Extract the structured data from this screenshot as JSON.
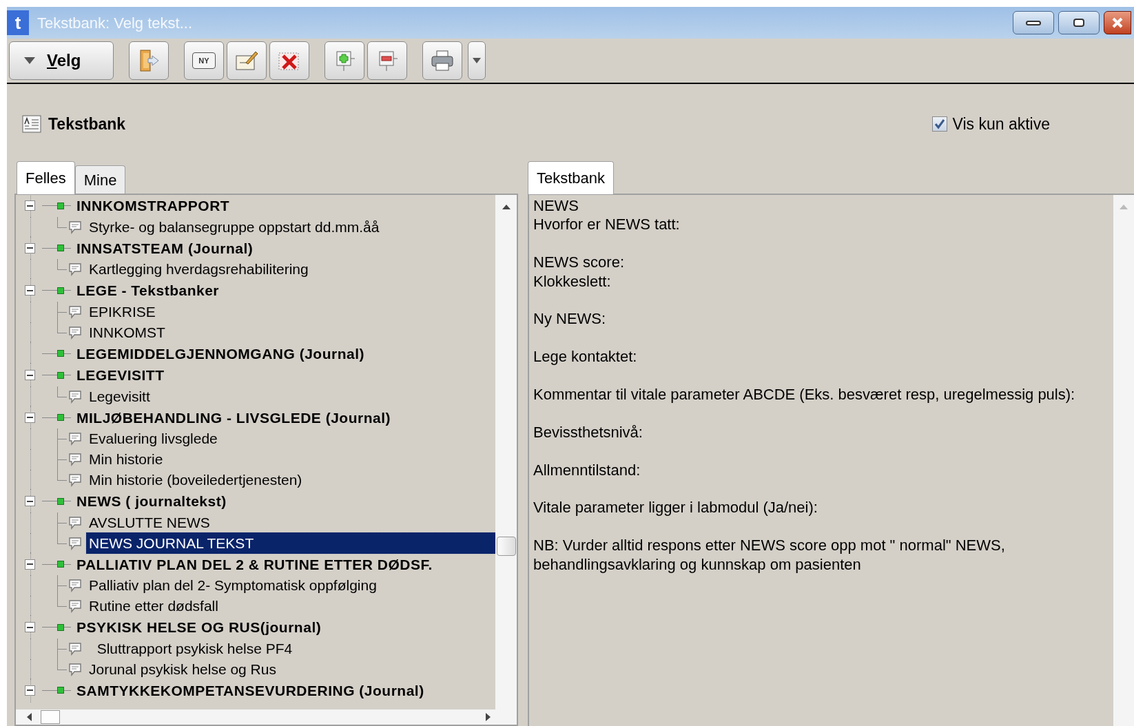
{
  "window": {
    "app_letter": "t",
    "title": "Tekstbank: Velg tekst..."
  },
  "toolbar": [
    {
      "kind": "menu",
      "label": "Velg"
    },
    {
      "kind": "exit"
    },
    {
      "kind": "new",
      "label": "NY"
    },
    {
      "kind": "edit"
    },
    {
      "kind": "delete"
    },
    {
      "kind": "add"
    },
    {
      "kind": "remove"
    },
    {
      "kind": "print"
    },
    {
      "kind": "dropdown"
    }
  ],
  "header": {
    "title": "Tekstbank"
  },
  "filter": {
    "label": "Vis kun aktive",
    "checked": true
  },
  "left_tabs": [
    {
      "label": "Felles",
      "selected": true
    },
    {
      "label": "Mine",
      "selected": false
    }
  ],
  "right_tabs": [
    {
      "label": "Tekstbank",
      "selected": true
    }
  ],
  "tree": [
    {
      "label": "INNKOMSTRAPPORT",
      "expanded": true,
      "children": [
        {
          "label": "Styrke- og balansegruppe oppstart dd.mm.åå",
          "selected": false
        }
      ]
    },
    {
      "label": "INNSATSTEAM (Journal)",
      "expanded": true,
      "children": [
        {
          "label": "Kartlegging hverdagsrehabilitering",
          "selected": false
        }
      ]
    },
    {
      "label": "LEGE - Tekstbanker",
      "expanded": true,
      "children": [
        {
          "label": "EPIKRISE",
          "selected": false
        },
        {
          "label": "INNKOMST",
          "selected": false
        }
      ]
    },
    {
      "label": "LEGEMIDDELGJENNOMGANG (Journal)"
    },
    {
      "label": "LEGEVISITT",
      "expanded": true,
      "children": [
        {
          "label": "Legevisitt",
          "selected": false
        }
      ]
    },
    {
      "label": "MILJØBEHANDLING - LIVSGLEDE (Journal)",
      "expanded": true,
      "children": [
        {
          "label": "Evaluering livsglede",
          "selected": false
        },
        {
          "label": "Min historie",
          "selected": false
        },
        {
          "label": "Min historie (boveiledertjenesten)",
          "selected": false
        }
      ]
    },
    {
      "label": "NEWS ( journaltekst)",
      "expanded": true,
      "children": [
        {
          "label": "AVSLUTTE NEWS",
          "selected": false
        },
        {
          "label": "NEWS JOURNAL TEKST",
          "selected": true
        }
      ]
    },
    {
      "label": "PALLIATIV PLAN DEL 2 & RUTINE ETTER DØDSF.",
      "expanded": true,
      "children": [
        {
          "label": "Palliativ plan del 2- Symptomatisk oppfølging",
          "selected": false
        },
        {
          "label": "Rutine etter dødsfall",
          "selected": false
        }
      ]
    },
    {
      "label": "PSYKISK HELSE OG RUS(journal)",
      "expanded": true,
      "children": [
        {
          "label": "  Sluttrapport psykisk helse PF4",
          "selected": false
        },
        {
          "label": "Jorunal psykisk helse og Rus",
          "selected": false
        }
      ]
    },
    {
      "label": "SAMTYKKEKOMPETANSEVURDERING (Journal)",
      "expanded": true
    }
  ],
  "text_blocks": [
    [
      "NEWS",
      "Hvorfor er NEWS tatt:"
    ],
    [
      "NEWS score:",
      "Klokkeslett:"
    ],
    [
      "Ny NEWS:"
    ],
    [
      "Lege kontaktet:"
    ],
    [
      "Kommentar til vitale parameter ABCDE (Eks. besværet resp, uregelmessig puls):"
    ],
    [
      "Bevissthetsnivå:"
    ],
    [
      "Allmenntilstand:"
    ],
    [
      "Vitale parameter ligger i labmodul (Ja/nei):"
    ],
    [
      "NB: Vurder alltid respons etter NEWS score opp mot \" normal\" NEWS,",
      "behandlingsavklaring og kunnskap om pasienten"
    ]
  ]
}
